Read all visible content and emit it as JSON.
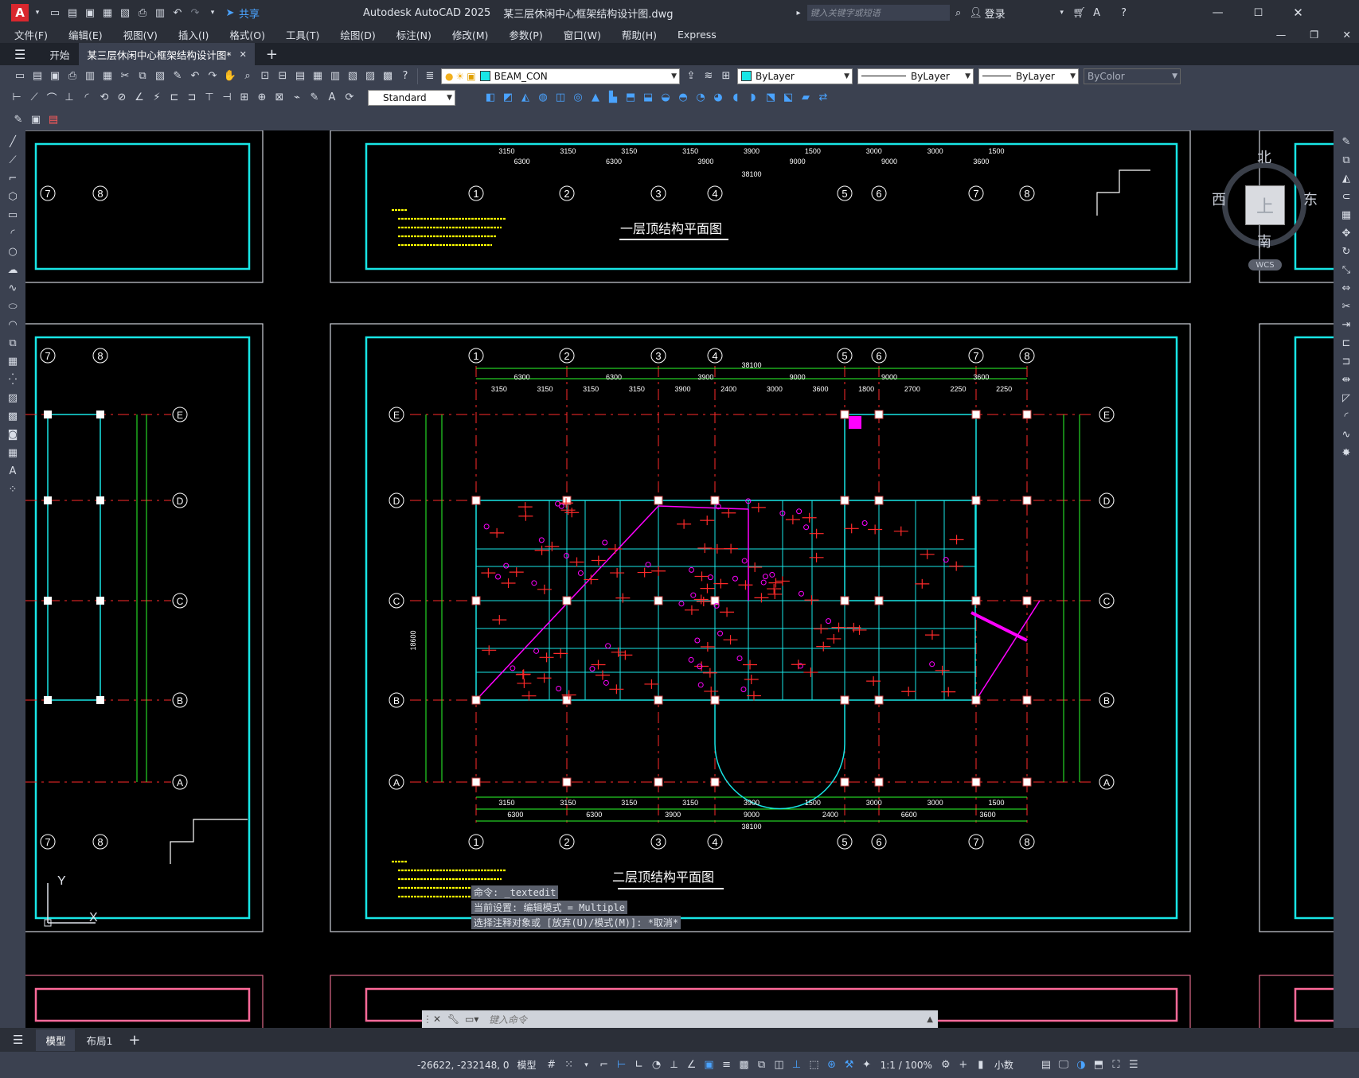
{
  "app": {
    "title": "Autodesk AutoCAD 2025",
    "filename": "某三层休闲中心框架结构设计图.dwg",
    "search_placeholder": "键入关键字或短语",
    "login": "登录",
    "share": "共享"
  },
  "menu": [
    "文件(F)",
    "编辑(E)",
    "视图(V)",
    "插入(I)",
    "格式(O)",
    "工具(T)",
    "绘图(D)",
    "标注(N)",
    "修改(M)",
    "参数(P)",
    "窗口(W)",
    "帮助(H)",
    "Express"
  ],
  "tabs": {
    "start": "开始",
    "active": "某三层休闲中心框架结构设计图*"
  },
  "layer": {
    "current": "BEAM_CON",
    "color": "ByLayer",
    "linetype": "ByLayer",
    "lineweight": "ByLayer",
    "plotstyle": "ByColor"
  },
  "style": {
    "text_style": "Standard"
  },
  "viewcube": {
    "north": "北",
    "south": "南",
    "east": "东",
    "west": "西",
    "top": "上",
    "wcs": "WCS"
  },
  "drawing": {
    "title1": "一层顶结构平面图",
    "title2": "二层顶结构平面图",
    "grid_numbers": [
      "1",
      "2",
      "3",
      "4",
      "5",
      "6",
      "7",
      "8"
    ],
    "grid_letters": [
      "A",
      "B",
      "C",
      "D",
      "E"
    ],
    "dims_top": [
      "6300",
      "6300",
      "3900",
      "9000",
      "9000",
      "3600"
    ],
    "dims_sub": [
      "3150",
      "3150",
      "3150",
      "3150",
      "3900",
      "2400",
      "3000",
      "3600",
      "1800",
      "2700",
      "2250",
      "2250"
    ],
    "dims_bottom": [
      "6300",
      "6300",
      "3900",
      "9000",
      "2400",
      "6600",
      "3600"
    ],
    "dims_bottom_sub": [
      "3150",
      "3150",
      "3150",
      "3150",
      "3900",
      "1500",
      "3000",
      "3000",
      "1500"
    ],
    "total_width": "38100",
    "total_depth": "18600"
  },
  "command": {
    "line1": "命令: _textedit",
    "line2": "当前设置: 编辑模式 = Multiple",
    "line3": "选择注释对象或 [放弃(U)/模式(M)]: *取消*",
    "placeholder": "键入命令"
  },
  "layouts": {
    "model": "模型",
    "layout1": "布局1"
  },
  "status": {
    "coords": "-26622, -232148, 0",
    "model": "模型",
    "scale": "1:1 / 100%",
    "units": "小数"
  },
  "colors": {
    "frame": "#18e6e6",
    "axis": "#ff2a2a",
    "dim": "#2bff2b",
    "beam": "#ff00ff",
    "note": "#ffff00"
  }
}
